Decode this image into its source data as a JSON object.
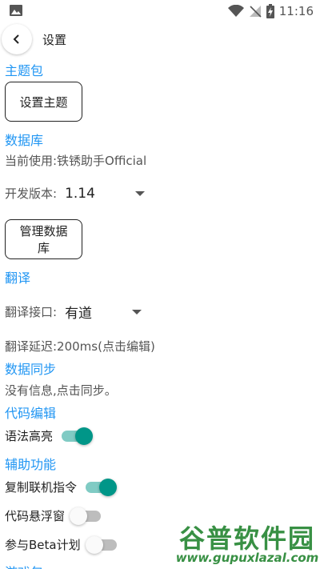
{
  "status_bar": {
    "time": "11:16"
  },
  "toolbar": {
    "title": "设置"
  },
  "theme": {
    "header": "主题包",
    "button": "设置主题"
  },
  "database": {
    "header": "数据库",
    "current": "当前使用:铁锈助手Official",
    "version_label": "开发版本:",
    "version_value": "1.14",
    "manage_button": "管理数据库"
  },
  "translation": {
    "header": "翻译",
    "api_label": "翻译接口:",
    "api_value": "有道",
    "delay_text": "翻译延迟:200ms(点击编辑)"
  },
  "sync": {
    "header": "数据同步",
    "info": "没有信息,点击同步。"
  },
  "code_edit": {
    "header": "代码编辑",
    "syntax_highlight": {
      "label": "语法高亮",
      "on": true
    }
  },
  "assist": {
    "header": "辅助功能",
    "copy_online_cmd": {
      "label": "复制联机指令",
      "on": true
    },
    "code_float": {
      "label": "代码悬浮窗",
      "on": false
    },
    "beta": {
      "label": "参与Beta计划",
      "on": false
    }
  },
  "next_header": "游戏包",
  "watermark": {
    "title": "谷普软件园",
    "url": "www.gupuxlazal.com"
  },
  "colors": {
    "accent": "#2196F3",
    "switch_on": "#009688"
  }
}
